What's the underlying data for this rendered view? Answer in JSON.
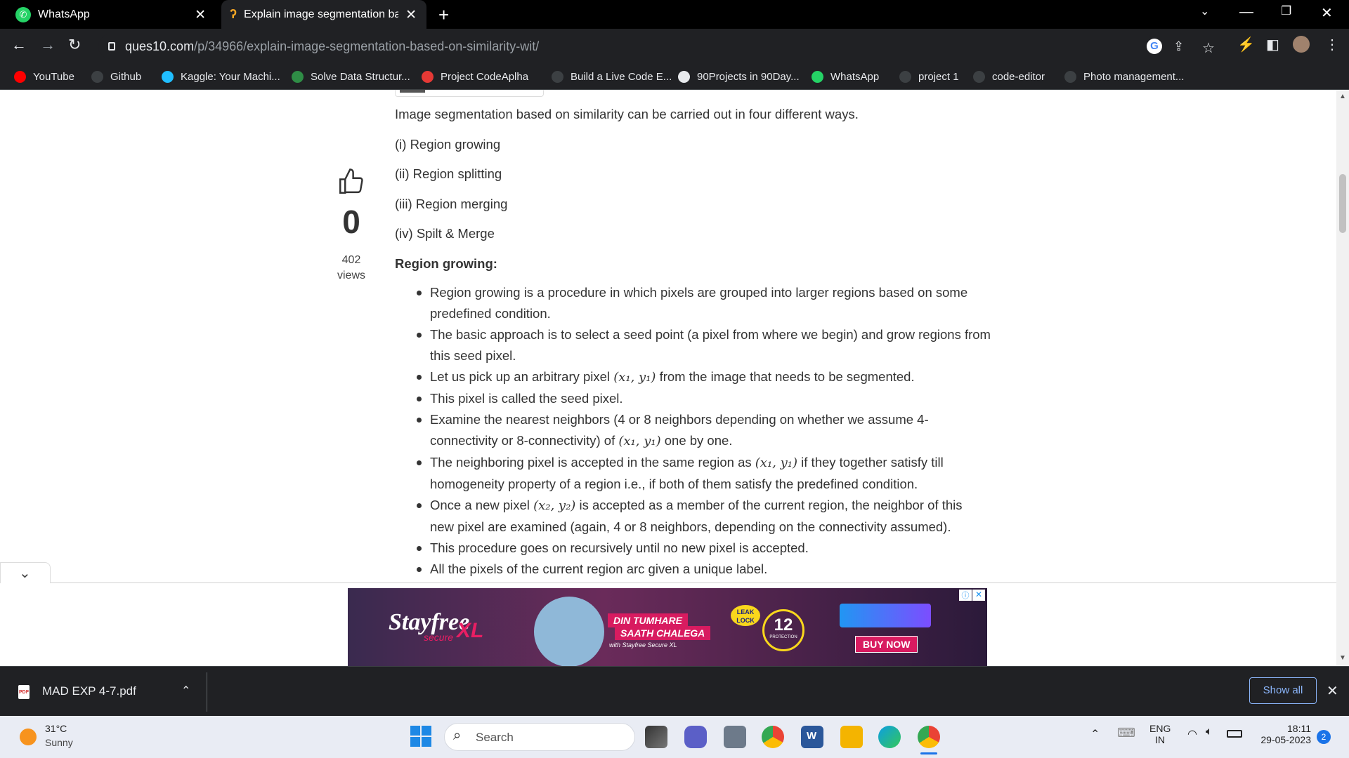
{
  "tabs": [
    {
      "title": "WhatsApp",
      "active": false
    },
    {
      "title": "Explain image segmentation base",
      "active": true
    }
  ],
  "address": {
    "host": "ques10.com",
    "path": "/p/34966/explain-image-segmentation-based-on-similarity-wit/"
  },
  "bookmarks": [
    {
      "label": "YouTube",
      "color": "#ff0000"
    },
    {
      "label": "Github",
      "color": "#3c4043"
    },
    {
      "label": "Kaggle: Your Machi...",
      "color": "#20beff"
    },
    {
      "label": "Solve Data Structur...",
      "color": "#2f8d46"
    },
    {
      "label": "Project CodeAplha",
      "color": "#e53935"
    },
    {
      "label": "Build a Live Code E...",
      "color": "#3c4043"
    },
    {
      "label": "90Projects in 90Day...",
      "color": "#e8eaed"
    },
    {
      "label": "WhatsApp",
      "color": "#25d366"
    },
    {
      "label": "project 1",
      "color": "#3c4043"
    },
    {
      "label": "code-editor",
      "color": "#3c4043"
    },
    {
      "label": "Photo management...",
      "color": "#3c4043"
    }
  ],
  "post": {
    "votes": "0",
    "views_count": "402",
    "views_label": "views",
    "intro": "Image segmentation based on similarity can be carried out in four different ways.",
    "methods": [
      "(i) Region growing",
      "(ii) Region splitting",
      "(iii) Region merging",
      "(iv) Spilt & Merge"
    ],
    "section_heading": "Region growing:",
    "bullets": [
      {
        "pre": "Region growing is a procedure in which pixels are grouped into larger regions based on some",
        "line2": "predefined condition."
      },
      {
        "pre": "The basic approach is to select a seed point (a pixel from where we begin) and grow regions from",
        "line2": "this seed pixel."
      },
      {
        "pre": "Let us pick up an arbitrary pixel ",
        "math": "(x₁, y₁)",
        "post": " from the image that needs to be segmented."
      },
      {
        "pre": "This pixel is called the seed pixel."
      },
      {
        "pre": "Examine the nearest neighbors (4 or 8 neighbors depending on whether we assume 4-",
        "line2pre": "connectivity or 8-connectivity) of ",
        "line2math": "(x₁, y₁)",
        "line2post": " one by one."
      },
      {
        "pre": "The neighboring pixel is accepted in the same region as ",
        "math": "(x₁, y₁)",
        "post": " if they together satisfy till",
        "line2": "homogeneity property of a region i.e., if both of them satisfy the predefined condition."
      },
      {
        "pre": "Once a new pixel ",
        "math": "(x₂, y₂)",
        "post": " is accepted as a member of the current region, the neighbor of this",
        "line2": "new pixel are examined (again, 4 or 8 neighbors, depending on the connectivity assumed)."
      },
      {
        "pre": "This procedure goes on recursively until no new pixel is accepted."
      },
      {
        "pre": "All the pixels of the current region arc given a unique label."
      }
    ]
  },
  "ad": {
    "brand": "Stayfree",
    "brand_sub": "secure",
    "brand_xl": "XL",
    "tagline_1": "DIN TUMHARE",
    "tagline_2": "SAATH CHALEGA",
    "tagline_3": "with Stayfree Secure XL",
    "badge_1": "LEAK",
    "badge_2": "LOCK",
    "hours": "12",
    "hours_label": "PROTECTION",
    "cta": "BUY NOW"
  },
  "download": {
    "file": "MAD EXP 4-7.pdf",
    "show_all": "Show all"
  },
  "taskbar": {
    "temp": "31°C",
    "weather": "Sunny",
    "search_placeholder": "Search",
    "lang_1": "ENG",
    "lang_2": "IN",
    "time": "18:11",
    "date": "29-05-2023",
    "notif_count": "2"
  }
}
